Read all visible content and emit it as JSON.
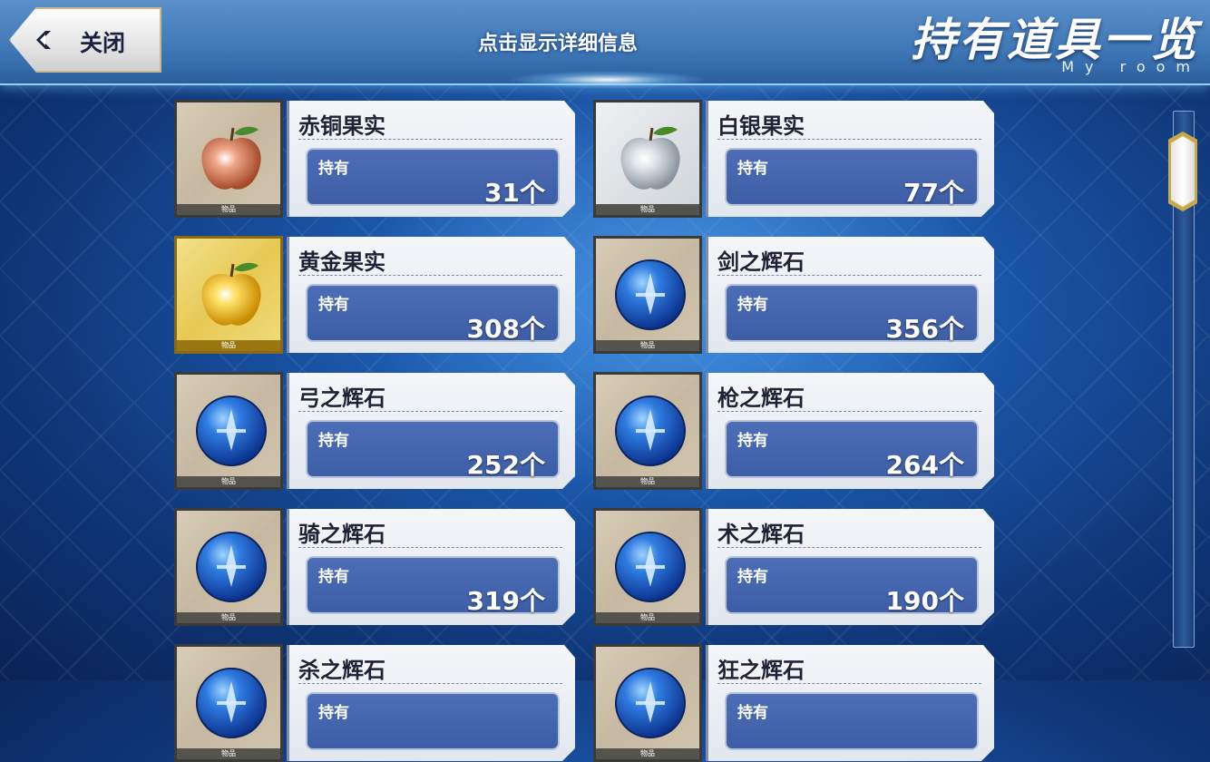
{
  "header": {
    "close_label": "关闭",
    "hint": "点击显示详细信息",
    "title": "持有道具一览",
    "subtitle": "My room"
  },
  "colors": {
    "accent": "#3d5ea6",
    "header": "#3f77b7",
    "gold": "#c9a94a"
  },
  "items": [
    {
      "name": "赤铜果实",
      "own_label": "持有",
      "count": "31个",
      "tag": "物品",
      "icon": "bronze-apple-icon"
    },
    {
      "name": "白银果实",
      "own_label": "持有",
      "count": "77个",
      "tag": "物品",
      "icon": "silver-apple-icon"
    },
    {
      "name": "黄金果实",
      "own_label": "持有",
      "count": "308个",
      "tag": "物品",
      "icon": "gold-apple-icon"
    },
    {
      "name": "剑之辉石",
      "own_label": "持有",
      "count": "356个",
      "tag": "物品",
      "icon": "saber-gem-icon"
    },
    {
      "name": "弓之辉石",
      "own_label": "持有",
      "count": "252个",
      "tag": "物品",
      "icon": "archer-gem-icon"
    },
    {
      "name": "枪之辉石",
      "own_label": "持有",
      "count": "264个",
      "tag": "物品",
      "icon": "lancer-gem-icon"
    },
    {
      "name": "骑之辉石",
      "own_label": "持有",
      "count": "319个",
      "tag": "物品",
      "icon": "rider-gem-icon"
    },
    {
      "name": "术之辉石",
      "own_label": "持有",
      "count": "190个",
      "tag": "物品",
      "icon": "caster-gem-icon"
    },
    {
      "name": "杀之辉石",
      "own_label": "持有",
      "count": "",
      "tag": "物品",
      "icon": "assassin-gem-icon"
    },
    {
      "name": "狂之辉石",
      "own_label": "持有",
      "count": "",
      "tag": "物品",
      "icon": "berserker-gem-icon"
    }
  ]
}
